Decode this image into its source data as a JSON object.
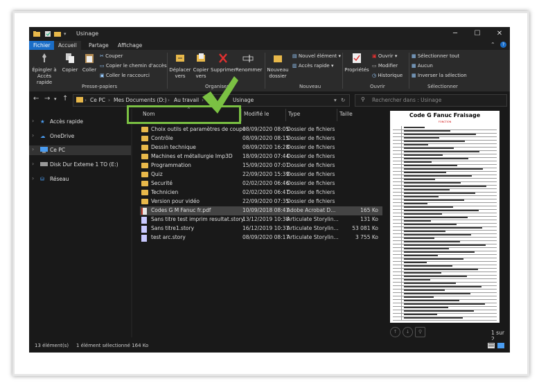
{
  "window": {
    "title": "Usinage"
  },
  "menu": [
    {
      "label": "Fichier"
    },
    {
      "label": "Accueil"
    },
    {
      "label": "Partage"
    },
    {
      "label": "Affichage"
    }
  ],
  "ribbon": {
    "pin_label": "Épingler à Accès rapide",
    "copy_label": "Copier",
    "paste_label": "Coller",
    "cut_label": "Couper",
    "copy_path_label": "Copier le chemin d'accès",
    "paste_shortcut_label": "Coller le raccourci",
    "group_clipboard": "Presse-papiers",
    "move_label": "Déplacer vers",
    "copyto_label": "Copier vers",
    "delete_label": "Supprimer",
    "rename_label": "Renommer",
    "group_organize": "Organiser",
    "newfolder_label": "Nouveau dossier",
    "newitem_label": "Nouvel élément",
    "quickaccess_label": "Accès rapide",
    "group_new": "Nouveau",
    "properties_label": "Propriétés",
    "open_label": "Ouvrir",
    "edit_label": "Modifier",
    "history_label": "Historique",
    "group_open": "Ouvrir",
    "selectall_label": "Sélectionner tout",
    "selectnone_label": "Aucun",
    "invert_label": "Inverser la sélection",
    "group_select": "Sélectionner"
  },
  "address": {
    "crumbs": [
      "Ce PC",
      "Mes Documents (D:)",
      "Au travail",
      "Usinage"
    ],
    "search_placeholder": "Rechercher dans : Usinage"
  },
  "nav": [
    {
      "label": "Accès rapide"
    },
    {
      "label": "OneDrive"
    },
    {
      "label": "Ce PC"
    },
    {
      "label": "Disk Dur Exteme 1 TO (E:)"
    },
    {
      "label": "Réseau"
    }
  ],
  "columns": {
    "name": "Nom",
    "date": "Modifié le",
    "type": "Type",
    "size": "Taille"
  },
  "files": [
    {
      "name": "Choix outils et paramètres de coupe",
      "date": "08/09/2020 08:05",
      "type": "Dossier de fichiers",
      "size": ""
    },
    {
      "name": "Contrôle",
      "date": "08/09/2020 08:15",
      "type": "Dossier de fichiers",
      "size": ""
    },
    {
      "name": "Dessin technique",
      "date": "08/09/2020 16:28",
      "type": "Dossier de fichiers",
      "size": ""
    },
    {
      "name": "Machines et métallurgie Imp3D",
      "date": "18/09/2020 07:44",
      "type": "Dossier de fichiers",
      "size": ""
    },
    {
      "name": "Programmation",
      "date": "15/09/2020 07:01",
      "type": "Dossier de fichiers",
      "size": ""
    },
    {
      "name": "Quiz",
      "date": "22/09/2020 15:39",
      "type": "Dossier de fichiers",
      "size": ""
    },
    {
      "name": "Securité",
      "date": "02/02/2020 06:46",
      "type": "Dossier de fichiers",
      "size": ""
    },
    {
      "name": "Technicien",
      "date": "02/02/2020 06:47",
      "type": "Dossier de fichiers",
      "size": ""
    },
    {
      "name": "Version pour vidéo",
      "date": "22/09/2020 07:35",
      "type": "Dossier de fichiers",
      "size": ""
    },
    {
      "name": "Codes G M Fanuc fr.pdf",
      "date": "10/09/2018 08:41",
      "type": "Adobe Acrobat D...",
      "size": "165 Ko"
    },
    {
      "name": "Sans titre test imprim resultat.story",
      "date": "13/12/2019 10:38",
      "type": "Articulate Storylin...",
      "size": "131 Ko"
    },
    {
      "name": "Sans titre1.story",
      "date": "16/12/2019 10:31",
      "type": "Articulate Storylin...",
      "size": "53 081 Ko"
    },
    {
      "name": "test arc.story",
      "date": "08/09/2020 08:17",
      "type": "Articulate Storylin...",
      "size": "3 755 Ko"
    }
  ],
  "preview": {
    "doc_title": "Code G Fanuc Fraisage",
    "doc_header": "FONCTION",
    "page_count": "1 sur 2"
  },
  "status": {
    "count": "13 élément(s)",
    "selected": "1 élément sélectionné  164 Ko"
  },
  "colors": {
    "accent": "#1a6dc7",
    "highlight": "#7bc143",
    "folder": "#e8b84a"
  }
}
